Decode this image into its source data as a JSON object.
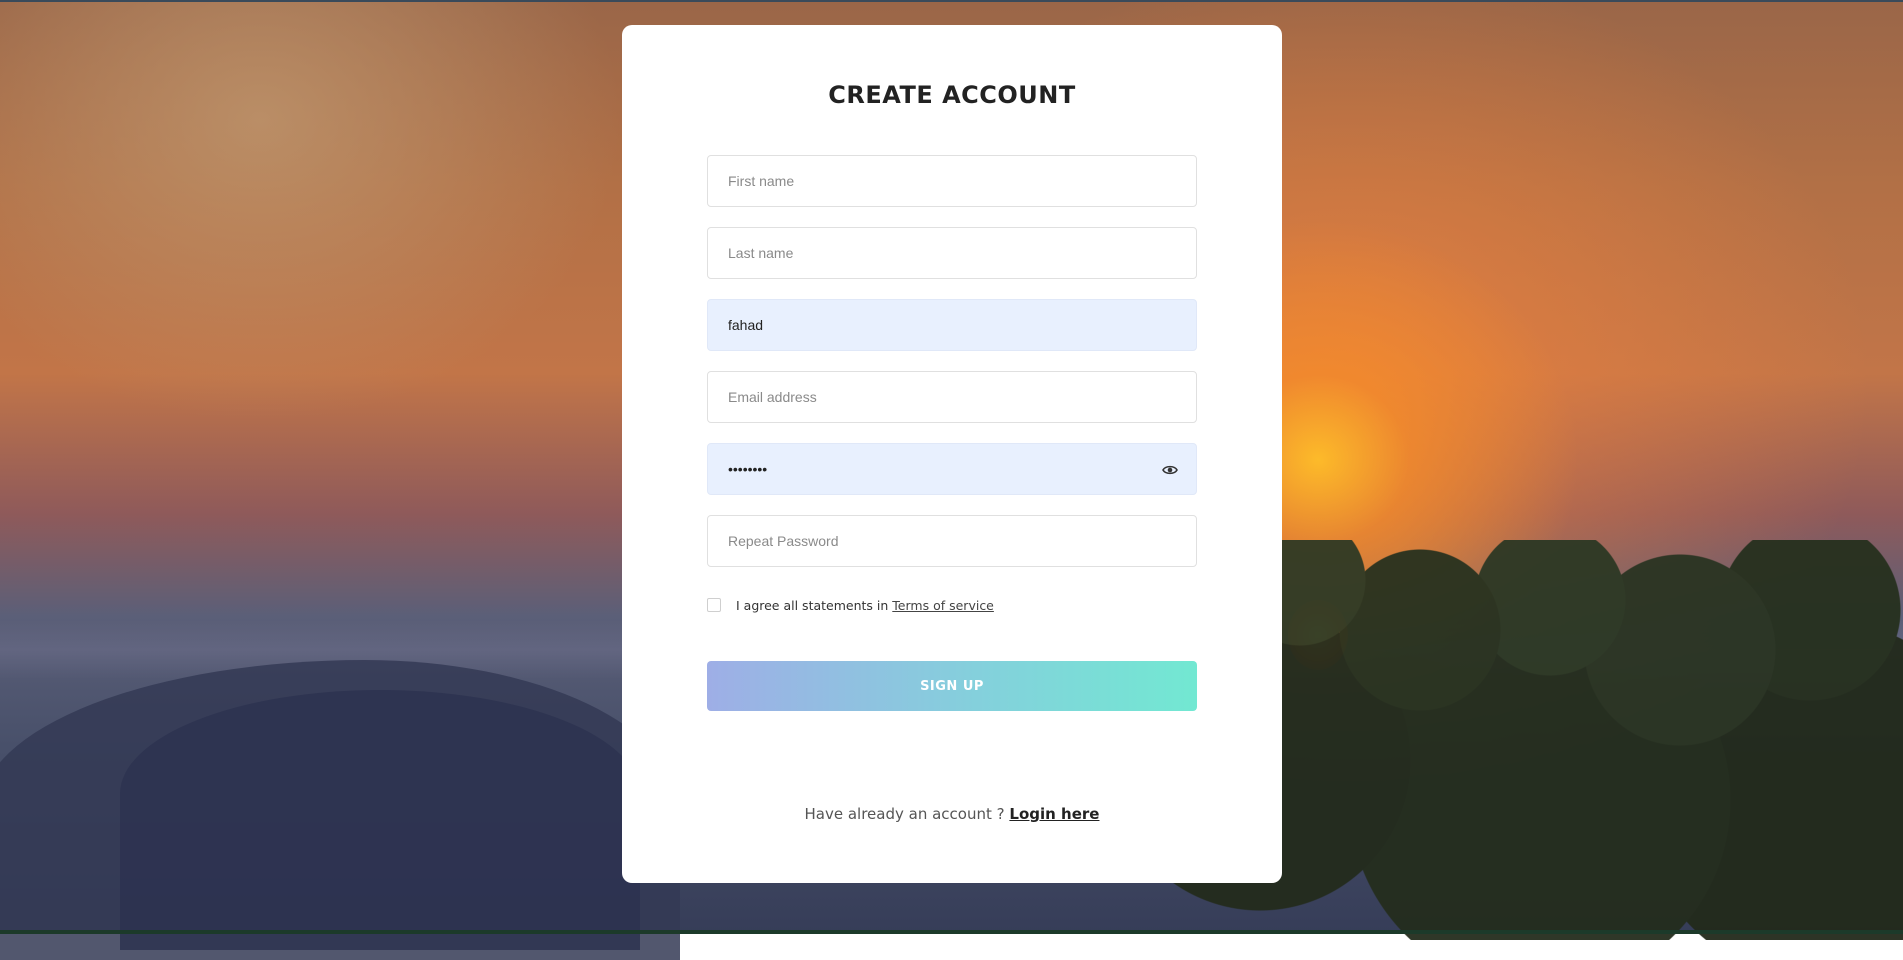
{
  "form": {
    "title": "CREATE ACCOUNT",
    "first_name": {
      "placeholder": "First name",
      "value": ""
    },
    "last_name": {
      "placeholder": "Last name",
      "value": ""
    },
    "username": {
      "placeholder": "",
      "value": "fahad"
    },
    "email": {
      "placeholder": "Email address",
      "value": ""
    },
    "password": {
      "placeholder": "",
      "value": "password"
    },
    "repeat_password": {
      "placeholder": "Repeat Password",
      "value": ""
    },
    "agree_text": "I agree all statements in",
    "terms_link": "Terms of service",
    "submit_label": "SIGN UP",
    "login_prompt": "Have already an account ?",
    "login_link": "Login here"
  },
  "icons": {
    "password_toggle": "eye-icon"
  },
  "colors": {
    "button_gradient_start": "#9eaee6",
    "button_gradient_end": "#72e8d2",
    "autofill_background": "#e8f0fe",
    "card_background": "#ffffff"
  }
}
